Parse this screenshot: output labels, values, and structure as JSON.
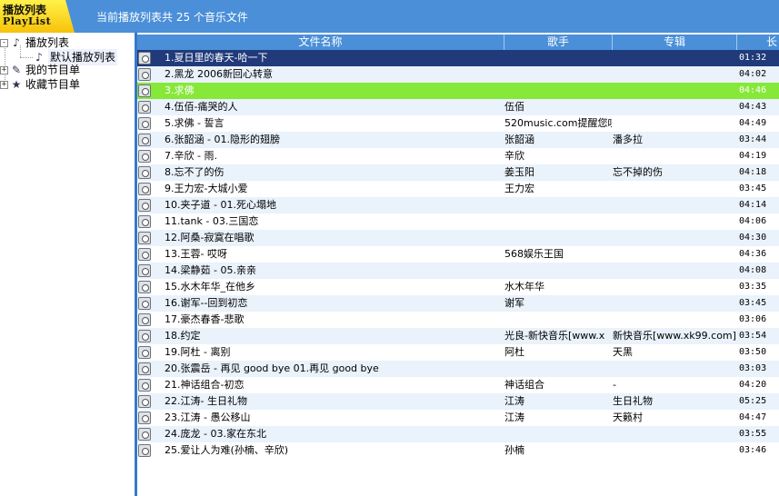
{
  "header": {
    "logo_cn": "播放列表",
    "logo_en": "PlayList",
    "status": "当前播放列表共 25 个音乐文件"
  },
  "tree": [
    {
      "label": "播放列表",
      "toggle": "-",
      "icon": "music-note-icon"
    },
    {
      "label": "默认播放列表",
      "icon": "music-note-icon",
      "selected": true
    },
    {
      "label": "我的节目单",
      "toggle": "+",
      "icon": "pencil-list-icon"
    },
    {
      "label": "收藏节目单",
      "toggle": "+",
      "icon": "star-list-icon"
    }
  ],
  "columns": {
    "title": "文件名称",
    "artist": "歌手",
    "album": "专辑",
    "duration": "长"
  },
  "rows": [
    {
      "title": "1.夏日里的春天-哈一下",
      "artist": "",
      "album": "",
      "duration": "01:32"
    },
    {
      "title": "2.黑龙 2006新回心转意",
      "artist": "",
      "album": "",
      "duration": "04:02"
    },
    {
      "title": "3.求佛",
      "artist": "",
      "album": "",
      "duration": "04:46"
    },
    {
      "title": "4.伍佰-痛哭的人",
      "artist": "伍佰",
      "album": "",
      "duration": "04:43"
    },
    {
      "title": "5.求佛 - 誓言",
      "artist": "520music.com提醒您叹",
      "album": "",
      "duration": "04:49"
    },
    {
      "title": "6.张韶涵 - 01.隐形的翅膀",
      "artist": "张韶涵",
      "album": "潘多拉",
      "duration": "03:44"
    },
    {
      "title": "7.辛欣 - 雨.",
      "artist": "辛欣",
      "album": "",
      "duration": "04:19"
    },
    {
      "title": "8.忘不了的伤",
      "artist": "姜玉阳",
      "album": "忘不掉的伤",
      "duration": "04:18"
    },
    {
      "title": "9.王力宏-大城小爱",
      "artist": "王力宏",
      "album": "",
      "duration": "03:45"
    },
    {
      "title": "10.夹子道 - 01.死心塌地",
      "artist": "",
      "album": "",
      "duration": "04:14"
    },
    {
      "title": "11.tank - 03.三国恋",
      "artist": "",
      "album": "",
      "duration": "04:06"
    },
    {
      "title": "12.阿桑-寂寞在唱歌",
      "artist": "",
      "album": "",
      "duration": "04:30"
    },
    {
      "title": "13.王蓉- 哎呀",
      "artist": "568娱乐王国",
      "album": "",
      "duration": "04:36"
    },
    {
      "title": "14.梁静茹 - 05.亲亲",
      "artist": "",
      "album": "",
      "duration": "04:08"
    },
    {
      "title": "15.水木年华_在他乡",
      "artist": "水木年华",
      "album": "",
      "duration": "03:35"
    },
    {
      "title": "16.谢军--回到初恋",
      "artist": "谢军",
      "album": "",
      "duration": "03:45"
    },
    {
      "title": "17.豪杰春香-悲歌",
      "artist": "",
      "album": "",
      "duration": "03:06"
    },
    {
      "title": "18.约定",
      "artist": "光良-新快音乐[www.x",
      "album": "新快音乐[www.xk99.com]",
      "duration": "03:54"
    },
    {
      "title": "19.阿杜 - 离别",
      "artist": "阿杜",
      "album": "天黑",
      "duration": "03:50"
    },
    {
      "title": "20.张震岳 - 再见 good bye 01.再见 good bye",
      "artist": "",
      "album": "",
      "duration": "03:03"
    },
    {
      "title": "21.神话组合-初恋",
      "artist": "神话组合",
      "album": "-",
      "duration": "04:20"
    },
    {
      "title": "22.江涛- 生日礼物",
      "artist": "江涛",
      "album": "生日礼物",
      "duration": "05:25"
    },
    {
      "title": "23.江涛 - 愚公移山",
      "artist": "江涛",
      "album": "天籁村",
      "duration": "04:47"
    },
    {
      "title": "24.庞龙 - 03.家在东北",
      "artist": "",
      "album": "",
      "duration": "03:55"
    },
    {
      "title": "25.爱让人为难(孙楠、辛欣)",
      "artist": "孙楠",
      "album": "",
      "duration": "03:46"
    }
  ],
  "current_row": 1,
  "highlighted_row": 3,
  "colors": {
    "header_blue": "#4a8fd8",
    "current_row": "#203a7a",
    "highlight_row": "#86e838",
    "alt_row": "#eaf2fc",
    "logo_yellow": "#f7c20a"
  }
}
